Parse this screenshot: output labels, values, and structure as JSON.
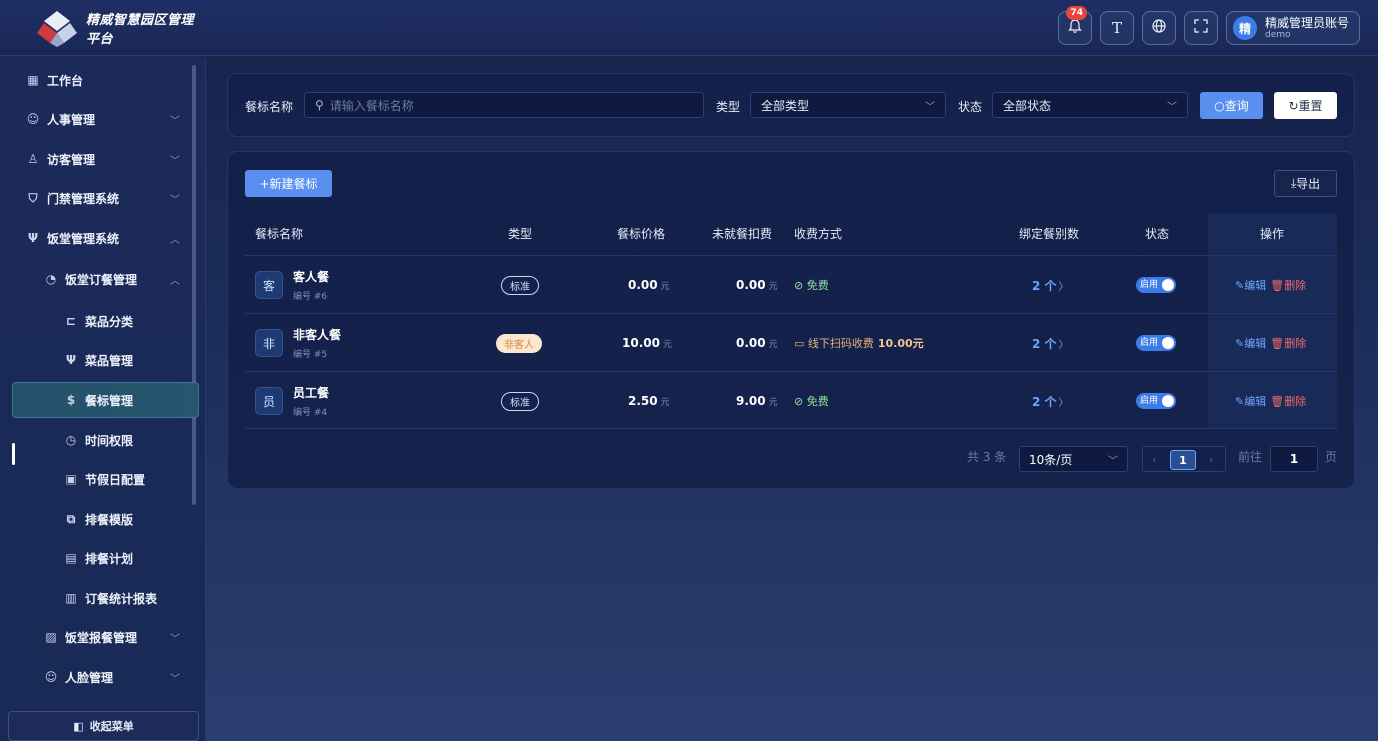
{
  "app": {
    "title": "精威智慧园区管理平台",
    "notification_count": "74",
    "font_btn": "T",
    "user": {
      "avatar": "精",
      "name": "精威管理员账号",
      "sub": "demo"
    }
  },
  "sidebar": {
    "items": [
      {
        "label": "工作台",
        "icon": "dashboard-icon"
      },
      {
        "label": "人事管理",
        "icon": "users-icon"
      },
      {
        "label": "访客管理",
        "icon": "visitor-icon"
      },
      {
        "label": "门禁管理系统",
        "icon": "shield-icon"
      },
      {
        "label": "饭堂管理系统",
        "icon": "fork-icon"
      },
      {
        "label": "饭堂订餐管理",
        "icon": "order-icon"
      },
      {
        "label": "菜品分类",
        "icon": "category-icon"
      },
      {
        "label": "菜品管理",
        "icon": "fork-icon"
      },
      {
        "label": "餐标管理",
        "icon": "dollar-icon"
      },
      {
        "label": "时间权限",
        "icon": "clock-icon"
      },
      {
        "label": "节假日配置",
        "icon": "calendar-icon"
      },
      {
        "label": "排餐模版",
        "icon": "template-icon"
      },
      {
        "label": "排餐计划",
        "icon": "plan-icon"
      },
      {
        "label": "订餐统计报表",
        "icon": "chart-icon"
      },
      {
        "label": "饭堂报餐管理",
        "icon": "clipboard-icon"
      },
      {
        "label": "人脸管理",
        "icon": "face-icon"
      }
    ],
    "collapse_label": "收起菜单"
  },
  "search": {
    "name_label": "餐标名称",
    "name_placeholder": "请输入餐标名称",
    "type_label": "类型",
    "type_value": "全部类型",
    "status_label": "状态",
    "status_value": "全部状态",
    "query_label": "查询",
    "reset_label": "重置"
  },
  "toolbar": {
    "new_label": "+新建餐标",
    "export_label": "导出"
  },
  "table": {
    "headers": [
      "餐标名称",
      "类型",
      "餐标价格",
      "未就餐扣费",
      "收费方式",
      "绑定餐别数",
      "状态",
      "操作"
    ],
    "unit": "元",
    "rows": [
      {
        "avatar": "客",
        "name": "客人餐",
        "code": "编号 #6",
        "type": "标准",
        "price": "0.00",
        "fee": "0.00",
        "pay": "免费",
        "pay_amount": "",
        "bind": "2 个",
        "status": "启用",
        "edit": "编辑",
        "delete": "删除"
      },
      {
        "avatar": "非",
        "name": "非客人餐",
        "code": "编号 #5",
        "type": "非客人",
        "price": "10.00",
        "fee": "0.00",
        "pay": "线下扫码收费",
        "pay_amount": "10.00元",
        "bind": "2 个",
        "status": "启用",
        "edit": "编辑",
        "delete": "删除"
      },
      {
        "avatar": "员",
        "name": "员工餐",
        "code": "编号 #4",
        "type": "标准",
        "price": "2.50",
        "fee": "9.00",
        "pay": "免费",
        "pay_amount": "",
        "bind": "2 个",
        "status": "启用",
        "edit": "编辑",
        "delete": "删除"
      }
    ]
  },
  "pagination": {
    "total": "共 3 条",
    "page_size": "10条/页",
    "current": "1",
    "goto_label": "前往",
    "goto_value": "1",
    "page_unit": "页"
  }
}
